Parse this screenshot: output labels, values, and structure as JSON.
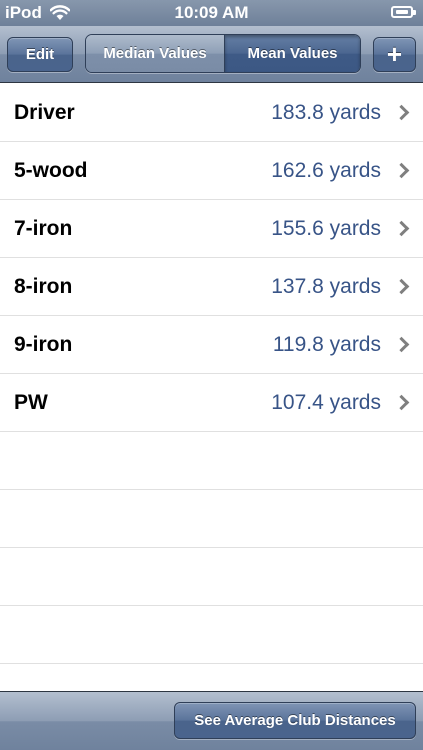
{
  "status_bar": {
    "carrier": "iPod",
    "time": "10:09 AM",
    "wifi_icon": "wifi-icon",
    "battery_icon": "battery-charging-icon"
  },
  "toolbar": {
    "edit_label": "Edit",
    "segments": [
      {
        "label": "Median Values",
        "selected": false
      },
      {
        "label": "Mean Values",
        "selected": true
      }
    ],
    "add_label": "+"
  },
  "clubs": [
    {
      "name": "Driver",
      "value": "183.8 yards"
    },
    {
      "name": "5-wood",
      "value": "162.6 yards"
    },
    {
      "name": "7-iron",
      "value": "155.6 yards"
    },
    {
      "name": "8-iron",
      "value": "137.8 yards"
    },
    {
      "name": "9-iron",
      "value": "119.8 yards"
    },
    {
      "name": "PW",
      "value": "107.4 yards"
    }
  ],
  "bottom_bar": {
    "average_label": "See Average Club Distances"
  },
  "colors": {
    "bar_blue": "#6f829d",
    "value_blue": "#385487",
    "selected_segment": "#3e5a86"
  }
}
